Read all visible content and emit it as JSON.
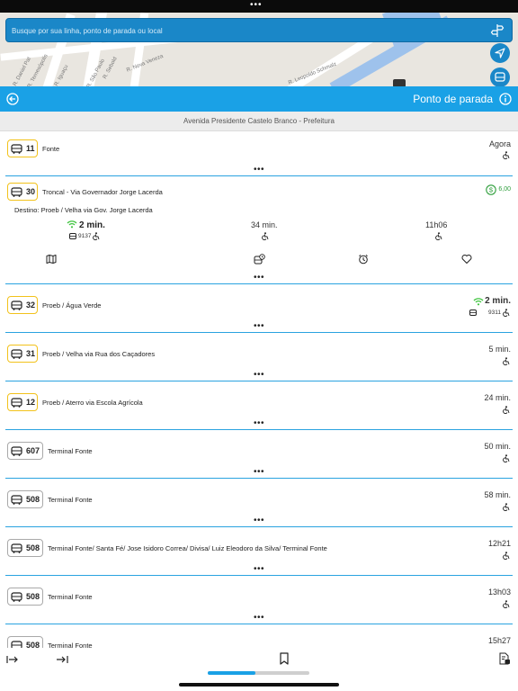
{
  "search": {
    "placeholder": "Busque por sua linha, ponto de parada ou local"
  },
  "map": {
    "streets": [
      "R. Daniel Pat",
      "R. Ternesópolis",
      "R. Iguaçu",
      "R. São Paulo",
      "R. Sebold",
      "R. Nova Veneza",
      "R. Leopoldo Schmalz",
      "Avenida Rua Rochedo"
    ]
  },
  "header": {
    "title": "Ponto de parada"
  },
  "stop": {
    "name": "Avenida Presidente Castelo Branco - Prefeitura"
  },
  "colors": {
    "accent": "#1aa1e6",
    "badge_trunk": "#f2c21b",
    "badge_regular": "#a9a9a9",
    "divider": "#2aa3e0",
    "fare": "#2e9e3b",
    "wifi": "#3ec43e"
  },
  "lines": [
    {
      "number": "11",
      "name": "Fonte",
      "time": "Agora",
      "badge": "yellow"
    },
    {
      "number": "30",
      "name": "Troncal - Via Governador Jorge Lacerda",
      "badge": "yellow",
      "fare": "6,00",
      "destination": "Destino: Proeb / Velha via Gov. Jorge Lacerda",
      "departures": [
        {
          "time": "2 min.",
          "vehicle": "9137",
          "live": true
        },
        {
          "time": "34 min."
        },
        {
          "time": "11h06"
        }
      ],
      "actions": [
        "map-icon",
        "bus-schedule-icon",
        "alarm-icon",
        "favorite-icon"
      ]
    },
    {
      "number": "32",
      "name": "Proeb / Água Verde",
      "time": "2 min.",
      "vehicle": "9311",
      "live": true,
      "badge": "yellow"
    },
    {
      "number": "31",
      "name": "Proeb / Velha via Rua dos Caçadores",
      "time": "5 min.",
      "badge": "yellow"
    },
    {
      "number": "12",
      "name": "Proeb / Aterro via Escola Agrícola",
      "time": "24 min.",
      "badge": "yellow"
    },
    {
      "number": "607",
      "name": "Terminal Fonte",
      "time": "50 min.",
      "badge": "gray"
    },
    {
      "number": "508",
      "name": "Terminal Fonte",
      "time": "58 min.",
      "badge": "gray"
    },
    {
      "number": "508",
      "name": "Terminal Fonte/ Santa Fé/ Jose Isidoro Correa/ Divisa/ Luiz Eleodoro da Silva/ Terminal Fonte",
      "time": "12h21",
      "badge": "gray"
    },
    {
      "number": "508",
      "name": "Terminal Fonte",
      "time": "13h03",
      "badge": "gray"
    },
    {
      "number": "508",
      "name": "Terminal Fonte",
      "time": "15h27",
      "badge": "gray"
    }
  ],
  "toolbar": {
    "progress": 0.47
  }
}
